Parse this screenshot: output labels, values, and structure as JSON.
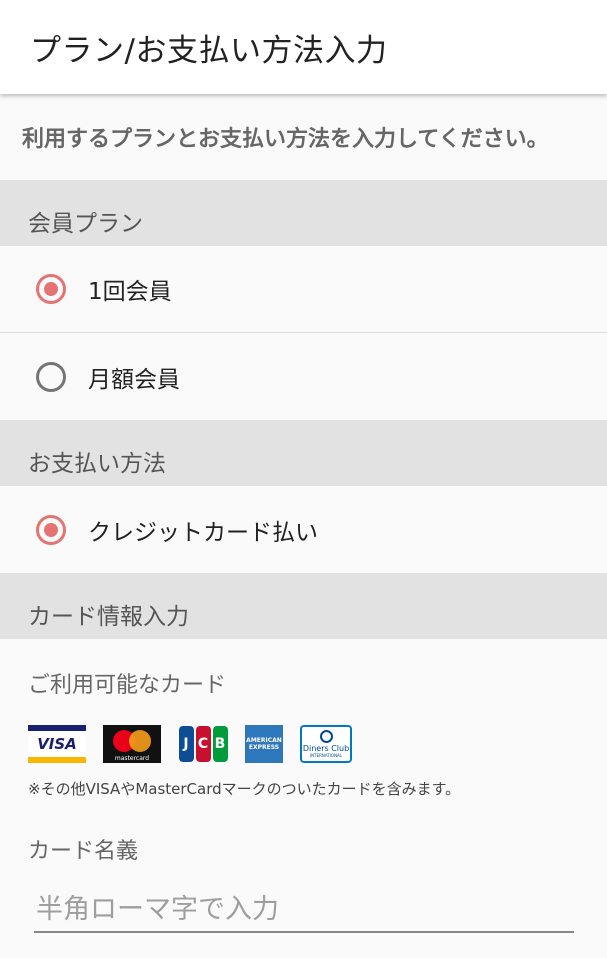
{
  "header": {
    "title": "プラン/お支払い方法入力"
  },
  "intro": "利用するプランとお支払い方法を入力してください。",
  "plan_section": {
    "title": "会員プラン",
    "options": [
      {
        "label": "1回会員",
        "selected": true
      },
      {
        "label": "月額会員",
        "selected": false
      }
    ]
  },
  "payment_section": {
    "title": "お支払い方法",
    "options": [
      {
        "label": "クレジットカード払い",
        "selected": true
      }
    ]
  },
  "card_section": {
    "title": "カード情報入力",
    "available_label": "ご利用可能なカード",
    "brands": [
      "VISA",
      "mastercard",
      "JCB",
      "AMERICAN EXPRESS",
      "Diners Club INTERNATIONAL"
    ],
    "brand_text": {
      "visa": "VISA",
      "mastercard": "mastercard",
      "jcb_j": "J",
      "jcb_c": "C",
      "jcb_b": "B",
      "amex": "AMERICAN EXPRESS",
      "diners": "Diners Club",
      "diners_sub": "INTERNATIONAL"
    },
    "note": "※その他VISAやMasterCardマークのついたカードを含みます。",
    "name_label": "カード名義",
    "name_placeholder": "半角ローマ字で入力",
    "name_value": ""
  },
  "colors": {
    "accent": "#e57373",
    "section_bg": "#e2e2e2",
    "page_bg": "#fafafa"
  }
}
